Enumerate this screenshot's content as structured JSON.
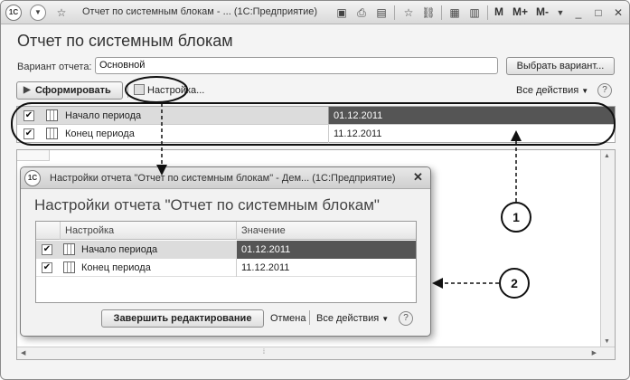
{
  "titlebar": {
    "logo": "1С",
    "title": "Отчет по системным блокам - ...  (1С:Предприятие)",
    "memory_buttons": [
      "M",
      "M+",
      "M-"
    ]
  },
  "form": {
    "title": "Отчет по системным блокам",
    "variant_label": "Вариант отчета:",
    "variant_value": "Основной",
    "choose_variant_button": "Выбрать вариант...",
    "generate_button": "Сформировать",
    "settings_link": "Настройка...",
    "all_actions": "Все действия",
    "help": "?"
  },
  "settings_table": {
    "rows": [
      {
        "checked": true,
        "name": "Начало периода",
        "value": "01.12.2011"
      },
      {
        "checked": true,
        "name": "Конец периода",
        "value": "11.12.2011"
      }
    ]
  },
  "dialog": {
    "title": "Настройки отчета \"Отчет по системным блокам\" - Дем...  (1С:Предприятие)",
    "heading": "Настройки отчета \"Отчет по системным блокам\"",
    "columns": [
      "Настройка",
      "Значение"
    ],
    "rows": [
      {
        "checked": true,
        "name": "Начало периода",
        "value": "01.12.2011"
      },
      {
        "checked": true,
        "name": "Конец периода",
        "value": "11.12.2011"
      }
    ],
    "finish_button": "Завершить редактирование",
    "cancel_link": "Отмена",
    "all_actions": "Все действия",
    "help": "?"
  },
  "callouts": [
    "1",
    "2"
  ],
  "colors": {
    "selected_row": "#d9d9d9",
    "selected_value": "#555555"
  }
}
